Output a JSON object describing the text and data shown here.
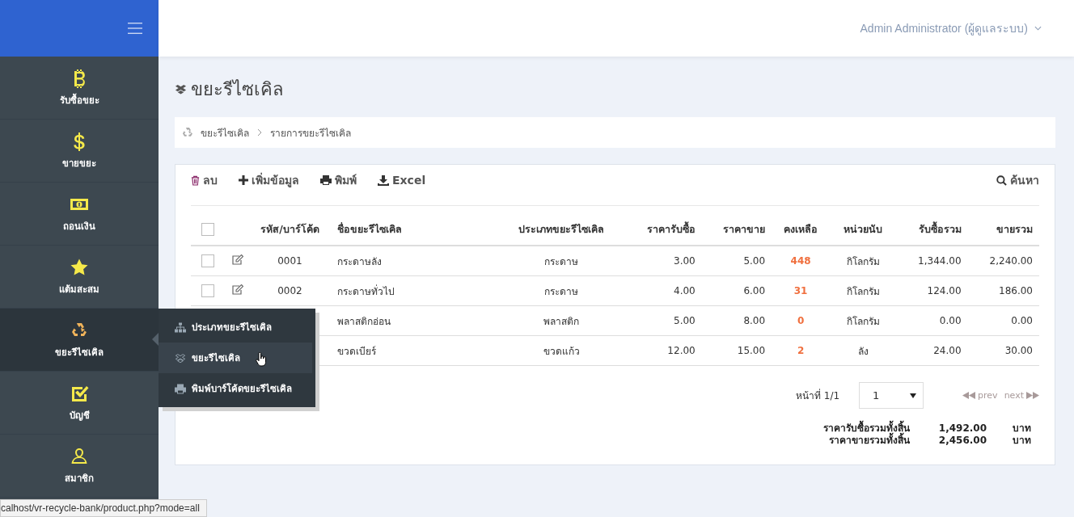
{
  "sidebar": {
    "items": [
      {
        "label": "รับซื้อขยะ",
        "selected": false
      },
      {
        "label": "ขายขยะ",
        "selected": false
      },
      {
        "label": "ถอนเงิน",
        "selected": false
      },
      {
        "label": "แต้มสะสม",
        "selected": false
      },
      {
        "label": "ขยะรีไซเคิล",
        "selected": true
      },
      {
        "label": "บัญชี",
        "selected": false
      },
      {
        "label": "สมาชิก",
        "selected": false
      }
    ]
  },
  "flyout_menu": {
    "items": [
      {
        "label": "ประเภทขยะรีไซเคิล",
        "selected": false
      },
      {
        "label": "ขยะรีไซเคิล",
        "selected": true
      },
      {
        "label": "พิมพ์บาร์โค้ดขยะรีไซเคิล",
        "selected": false
      }
    ]
  },
  "user_menu": {
    "label": "Admin Administrator (ผู้ดูแลระบบ)"
  },
  "page_title": "ขยะรีไซเคิล",
  "breadcrumb": [
    "ขยะรีไซเคิล",
    "รายการขยะรีไซเคิล"
  ],
  "toolbar": {
    "actions": [
      "ลบ",
      "เพิ่มข้อมูล",
      "พิมพ์",
      "Excel"
    ],
    "search": "ค้นหา"
  },
  "table": {
    "select_all_checked": false,
    "columns": [
      "รหัส/บาร์โค้ด",
      "ชื่อขยะรีไซเคิล",
      "ประเภทขยะรีไซเคิล",
      "ราคารับซื้อ",
      "ราคาขาย",
      "คงเหลือ",
      "หน่วยนับ",
      "รับซื้อรวม",
      "ขายรวม"
    ],
    "rows": [
      {
        "checked": false,
        "code": "0001",
        "name": "กระดาษลัง",
        "type": "กระดาษ",
        "buy_price": "3.00",
        "sell_price": "5.00",
        "remaining": "448",
        "unit": "กิโลกรัม",
        "buy_total": "1,344.00",
        "sell_total": "2,240.00"
      },
      {
        "checked": false,
        "code": "0002",
        "name": "กระดาษทั่วไป",
        "type": "กระดาษ",
        "buy_price": "4.00",
        "sell_price": "6.00",
        "remaining": "31",
        "unit": "กิโลกรัม",
        "buy_total": "124.00",
        "sell_total": "186.00"
      },
      {
        "name": "พลาสติกอ่อน",
        "type": "พลาสติก",
        "buy_price": "5.00",
        "sell_price": "8.00",
        "remaining": "0",
        "unit": "กิโลกรัม",
        "buy_total": "0.00",
        "sell_total": "0.00"
      },
      {
        "name": "ขวดเบียร์",
        "type": "ขวดแก้ว",
        "buy_price": "12.00",
        "sell_price": "15.00",
        "remaining": "2",
        "unit": "ลัง",
        "buy_total": "24.00",
        "sell_total": "30.00"
      }
    ]
  },
  "pagination": {
    "page_label": "หน้าที่ 1/1",
    "page_select": "1",
    "prev": {
      "label": "prev",
      "disabled": true
    },
    "next": {
      "label": "next",
      "disabled": true
    }
  },
  "totals": [
    {
      "label": "ราคารับซื้อรวมทั้งสิ้น",
      "value": "1,492.00",
      "unit": "บาท"
    },
    {
      "label": "ราคาขายรวมทั้งสิ้น",
      "value": "2,456.00",
      "unit": "บาท"
    }
  ],
  "status_bar": {
    "url": "calhost/vr-recycle-bank/product.php?mode=all"
  }
}
